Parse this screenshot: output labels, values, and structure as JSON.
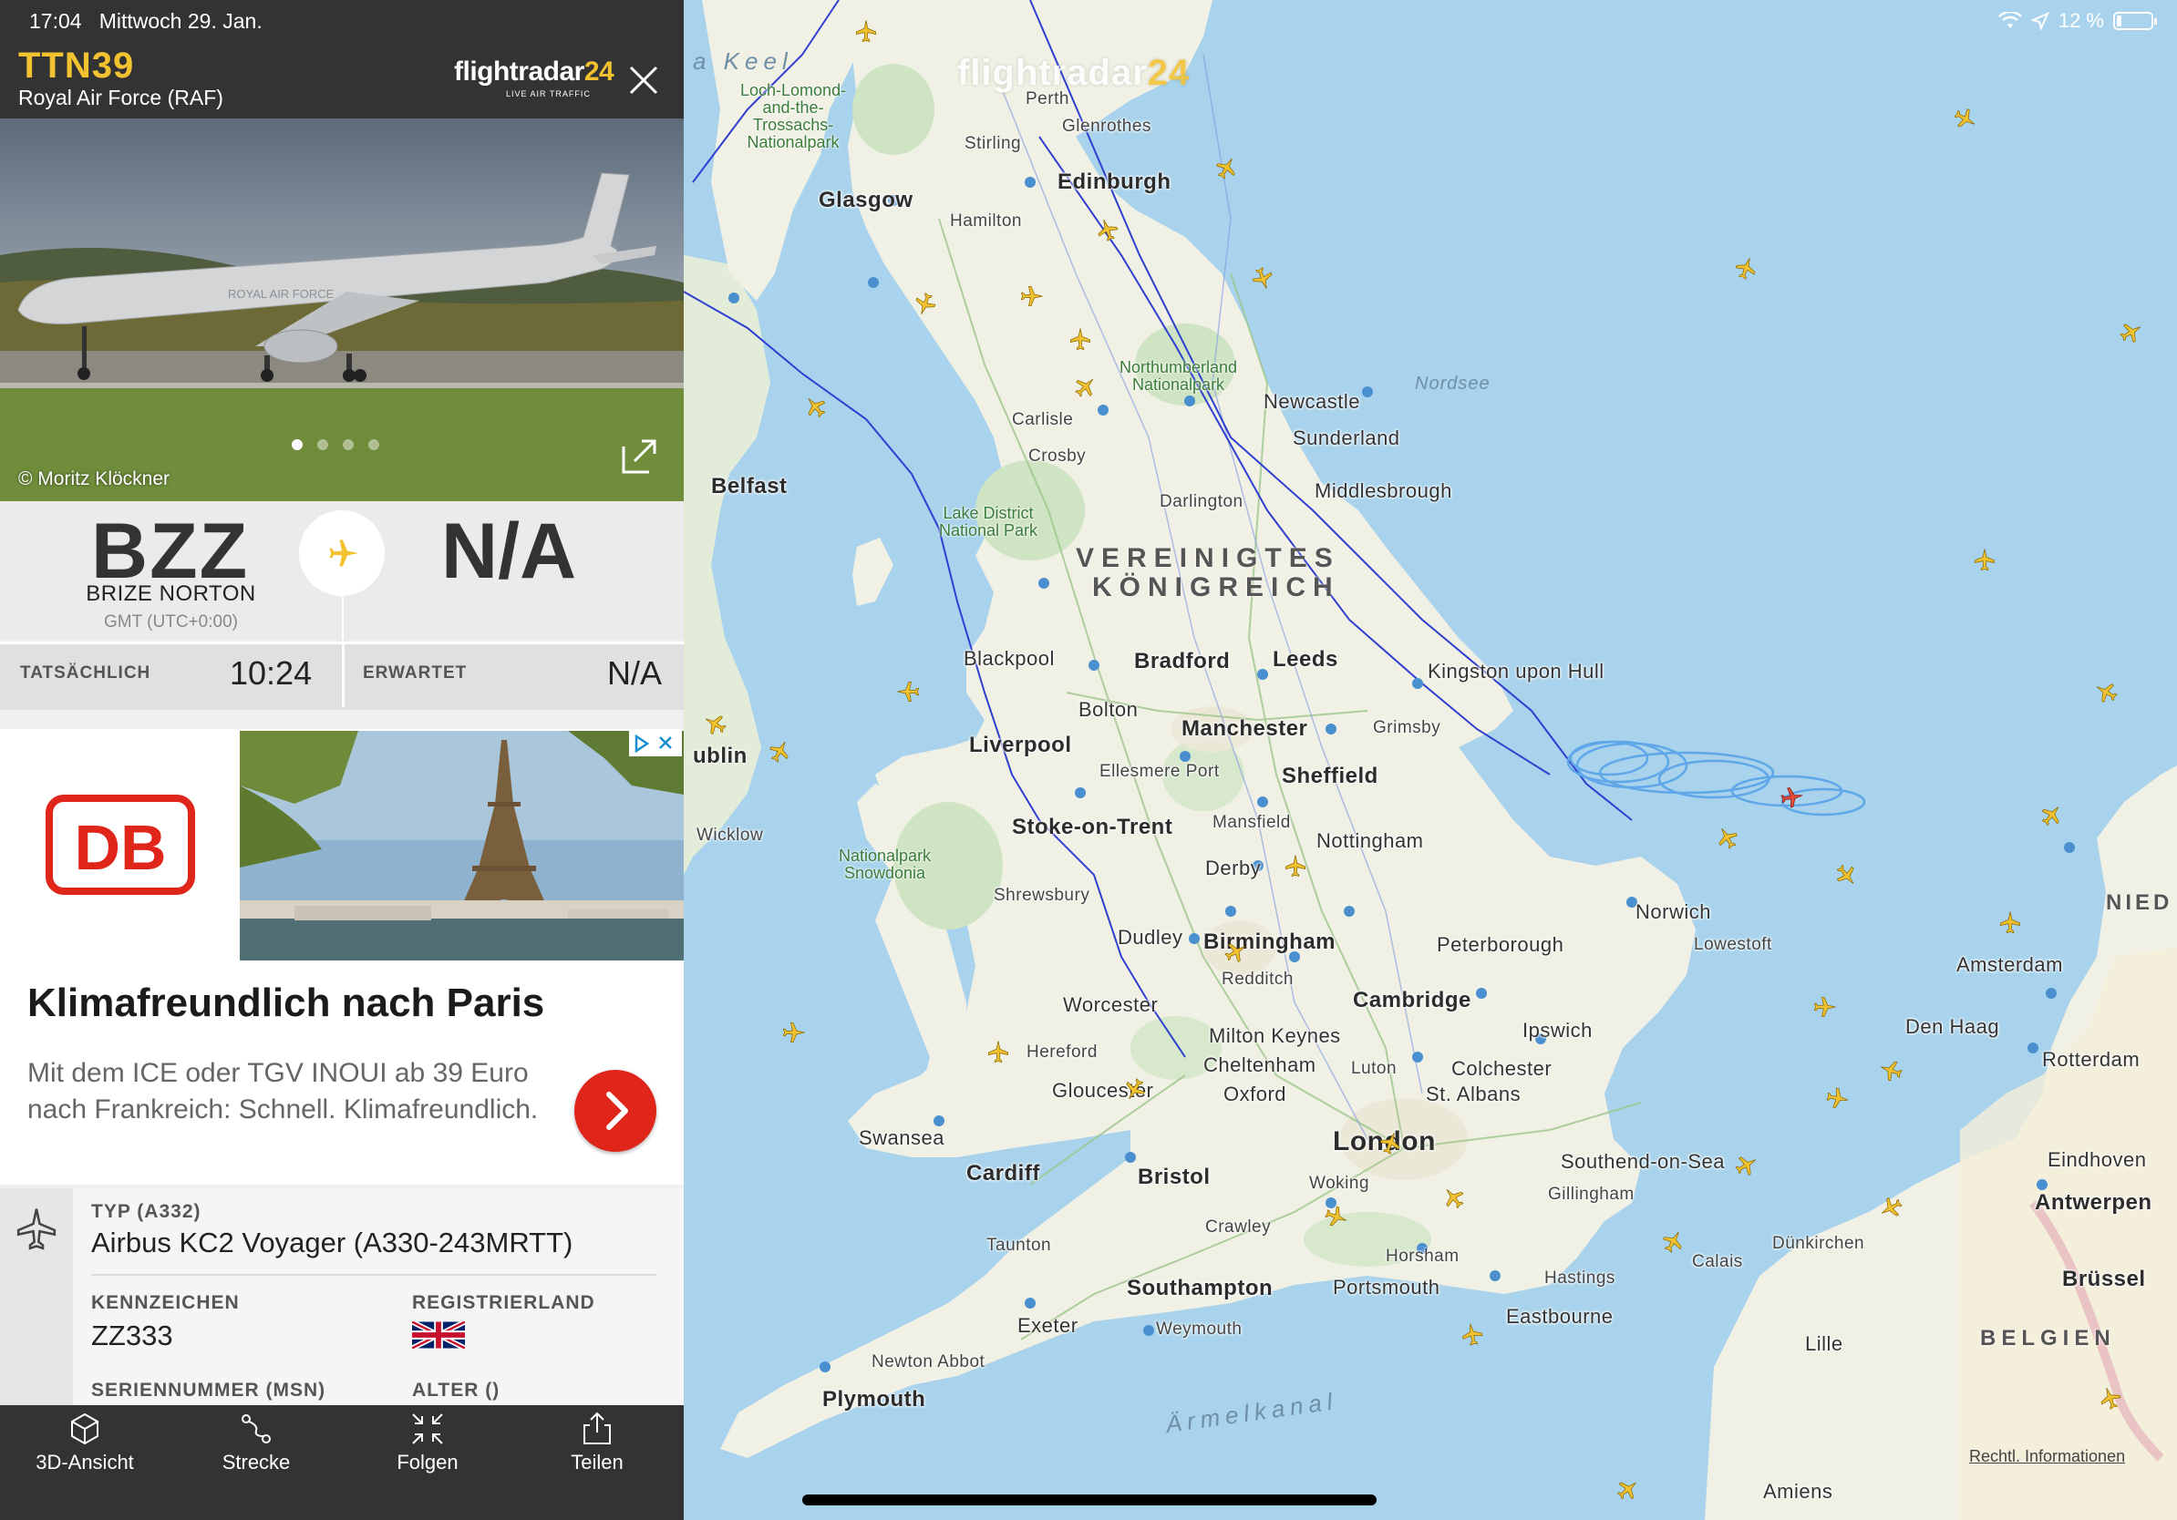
{
  "status_bar": {
    "time": "17:04",
    "date": "Mittwoch 29. Jan.",
    "battery": "12 %"
  },
  "flight": {
    "callsign": "TTN39",
    "operator": "Royal Air Force (RAF)",
    "brand": "flightradar",
    "brand_accent": "24",
    "brand_sub": "LIVE AIR TRAFFIC",
    "photo_credit": "© Moritz Klöckner",
    "photo_livery": "ROYAL AIR FORCE"
  },
  "route": {
    "from_iata": "BZZ",
    "from_name": "BRIZE NORTON",
    "from_tz": "GMT (UTC+0:00)",
    "to_iata": "N/A"
  },
  "times": {
    "actual_label": "TATSÄCHLICH",
    "actual_value": "10:24",
    "expected_label": "ERWARTET",
    "expected_value": "N/A"
  },
  "ad": {
    "logo": "DB",
    "title": "Klimafreundlich nach Paris",
    "text": "Mit dem ICE oder TGV INOUI ab 39 Euro nach Frankreich: Schnell. Klimafreundlich."
  },
  "aircraft": {
    "type_label": "TYP (A332)",
    "type_value": "Airbus KC2 Voyager (A330-243MRTT)",
    "reg_label": "KENNZEICHEN",
    "reg_value": "ZZ333",
    "country_label": "REGISTRIERLAND",
    "msn_label": "SERIENNUMMER (MSN)",
    "age_label": "ALTER ()"
  },
  "tabs": {
    "t3d": "3D-Ansicht",
    "route": "Strecke",
    "follow": "Folgen",
    "share": "Teilen"
  },
  "map": {
    "watermark": "flightradar",
    "watermark_accent": "24",
    "legal": "Rechtl. Informationen",
    "sea_north": "Nordsee",
    "sea_channel": "Ärmelkanal",
    "sea_keel": "a Keel",
    "country_uk_1": "VEREINIGTES",
    "country_uk_2": "KÖNIGREICH",
    "country_be": "BELGIEN",
    "country_nl": "NIED",
    "cities": {
      "perth": "Perth",
      "glenrothes": "Glenrothes",
      "stirling": "Stirling",
      "edinburgh": "Edinburgh",
      "glasgow": "Glasgow",
      "hamilton": "Hamilton",
      "carlisle": "Carlisle",
      "newcastle": "Newcastle",
      "sunderland": "Sunderland",
      "darlington": "Darlington",
      "middlesbrough": "Middlesbrough",
      "crosby": "Crosby",
      "belfast": "Belfast",
      "blackpool": "Blackpool",
      "bradford": "Bradford",
      "leeds": "Leeds",
      "hull": "Kingston upon Hull",
      "bolton": "Bolton",
      "manchester": "Manchester",
      "grimsby": "Grimsby",
      "liverpool": "Liverpool",
      "ellesmere": "Ellesmere Port",
      "sheffield": "Sheffield",
      "dublin": "ublin",
      "wicklow": "Wicklow",
      "stoke": "Stoke-on-Trent",
      "mansfield": "Mansfield",
      "nottingham": "Nottingham",
      "derby": "Derby",
      "shrewsbury": "Shrewsbury",
      "norwich": "Norwich",
      "lowestoft": "Lowestoft",
      "dudley": "Dudley",
      "birmingham": "Birmingham",
      "peterborough": "Peterborough",
      "redditch": "Redditch",
      "worcester": "Worcester",
      "cambridge": "Cambridge",
      "ipswich": "Ipswich",
      "hereford": "Hereford",
      "miltonkeynes": "Milton Keynes",
      "cheltenham": "Cheltenham",
      "luton": "Luton",
      "colchester": "Colchester",
      "gloucester": "Gloucester",
      "oxford": "Oxford",
      "stalbans": "St. Albans",
      "swansea": "Swansea",
      "london": "London",
      "southend": "Southend-on-Sea",
      "cardiff": "Cardiff",
      "bristol": "Bristol",
      "woking": "Woking",
      "gillingham": "Gillingham",
      "crawley": "Crawley",
      "taunton": "Taunton",
      "horsham": "Horsham",
      "dunkirchen": "Dünkirchen",
      "calais": "Calais",
      "southampton": "Southampton",
      "portsmouth": "Portsmouth",
      "hastings": "Hastings",
      "exeter": "Exeter",
      "eastbourne": "Eastbourne",
      "weymouth": "Weymouth",
      "newtonabbot": "Newton Abbot",
      "plymouth": "Plymouth",
      "amsterdam": "Amsterdam",
      "denhaag": "Den Haag",
      "rotterdam": "Rotterdam",
      "eindhoven": "Eindhoven",
      "antwerpen": "Antwerpen",
      "brussel": "Brüssel",
      "lille": "Lille",
      "amiens": "Amiens"
    },
    "parks": {
      "lochlomond": "Loch-Lomond-\nand-the-\nTrossachs-\nNationalpark",
      "northumberland": "Northumberland\nNationalpark",
      "lakedistrict": "Lake District\nNational Park",
      "snowdonia": "Nationalpark\nSnowdonia"
    }
  }
}
